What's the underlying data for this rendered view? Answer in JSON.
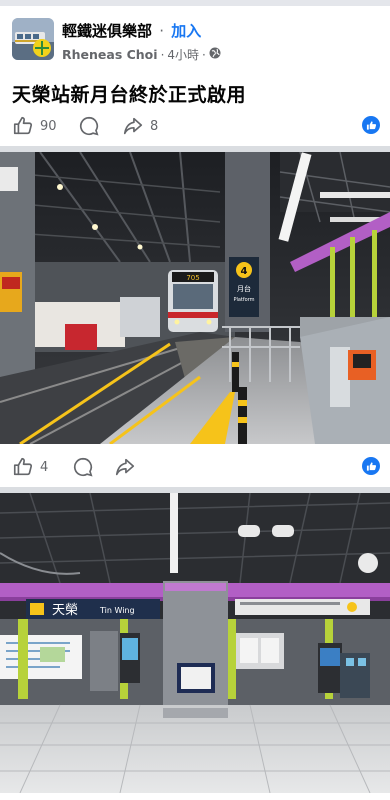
{
  "post": {
    "group_name": "輕鐵迷俱樂部",
    "separator": "·",
    "join_label": "加入",
    "author": "Rheneas Choi",
    "time": "4小時",
    "text": "天榮站新月台終於正式啟用",
    "likes": "90",
    "shares": "8"
  },
  "photo1": {
    "platform_number": "4",
    "platform_label_cn": "月台",
    "platform_label_en": "Platform",
    "route_sign": "705",
    "left_sign": "Exit"
  },
  "photo1_actions": {
    "likes": "4"
  },
  "photo2": {
    "station_cn": "天榮",
    "station_en": "Tin Wing"
  },
  "colors": {
    "facebook_blue": "#1877f2",
    "secondary_text": "#65676b",
    "station_purple": "#b25fc5",
    "platform_yellow": "#f6c31a"
  }
}
